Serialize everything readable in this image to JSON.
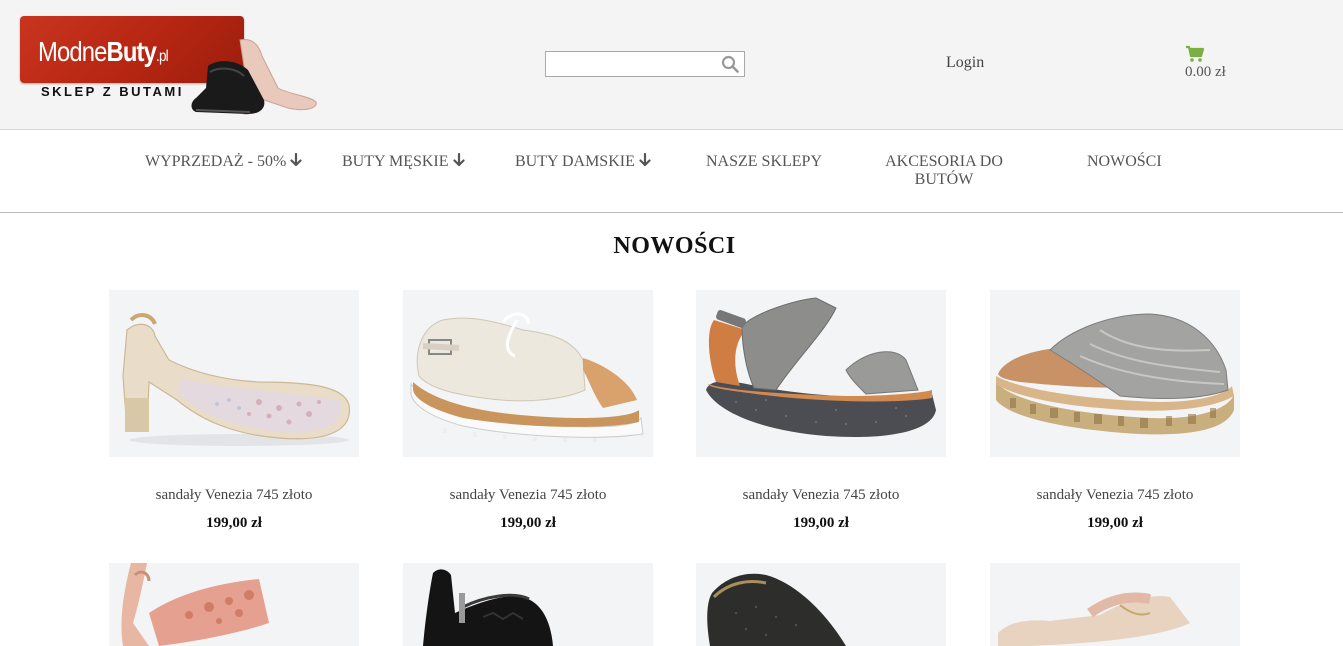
{
  "logo": {
    "brand_main": "Modne",
    "brand_bold": "Buty",
    "brand_tld": ".pl",
    "tagline": "SKLEP Z BUTAMI"
  },
  "header": {
    "search_placeholder": "",
    "search_icon": "search-icon",
    "login_label": "Login",
    "cart_icon": "cart-icon",
    "cart_amount": "0.00 zł",
    "accent_color": "#79b041",
    "brand_color": "#c0301a"
  },
  "nav": {
    "items": [
      {
        "label": "WYPRZEDAŻ - 50%",
        "has_dropdown": true
      },
      {
        "label": "BUTY MĘSKIE",
        "has_dropdown": true
      },
      {
        "label": "BUTY DAMSKIE",
        "has_dropdown": true
      },
      {
        "label": "NASZE SKLEPY",
        "has_dropdown": false
      },
      {
        "label_line1": "AKCESORIA DO",
        "label_line2": "BUTÓW",
        "has_dropdown": false
      },
      {
        "label": "NOWOŚCI",
        "has_dropdown": false
      }
    ]
  },
  "main": {
    "title": "NOWOŚCI",
    "products": [
      {
        "name": "sandały Venezia 745 złoto",
        "price": "199,00 zł"
      },
      {
        "name": "sandały Venezia 745 złoto",
        "price": "199,00 zł"
      },
      {
        "name": "sandały Venezia 745 złoto",
        "price": "199,00 zł"
      },
      {
        "name": "sandały Venezia 745 złoto",
        "price": "199,00 zł"
      }
    ]
  }
}
